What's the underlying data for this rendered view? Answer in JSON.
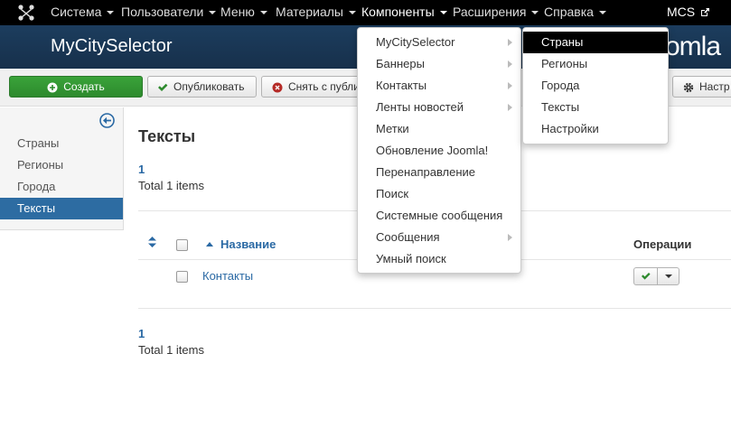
{
  "navbar": {
    "items": [
      "Система",
      "Пользователи",
      "Меню",
      "Материалы",
      "Компоненты",
      "Расширения",
      "Справка"
    ],
    "active": "Компоненты",
    "user": "MCS"
  },
  "header": {
    "title": "MyCitySelector",
    "joomla_fragment": "omla"
  },
  "toolbar": {
    "new": "Создать",
    "publish": "Опубликовать",
    "unpublish": "Снять с публи",
    "options": "Настр"
  },
  "sidebar": {
    "items": [
      "Страны",
      "Регионы",
      "Города",
      "Тексты"
    ],
    "active": "Тексты"
  },
  "main": {
    "title": "Тексты",
    "pagination_top": {
      "page": "1",
      "total": "Total 1 items"
    },
    "pagination_bottom": {
      "page": "1",
      "total": "Total 1 items"
    },
    "table": {
      "col_name": "Название",
      "col_ops": "Операции",
      "rows": [
        {
          "name": "Контакты",
          "published": true
        }
      ]
    }
  },
  "components_menu": {
    "items": [
      {
        "label": "MyCitySelector",
        "submenu": true
      },
      {
        "label": "Баннеры",
        "submenu": true
      },
      {
        "label": "Контакты",
        "submenu": true
      },
      {
        "label": "Ленты новостей",
        "submenu": true
      },
      {
        "label": "Метки",
        "submenu": false
      },
      {
        "label": "Обновление Joomla!",
        "submenu": false
      },
      {
        "label": "Перенаправление",
        "submenu": false
      },
      {
        "label": "Поиск",
        "submenu": false
      },
      {
        "label": "Системные сообщения",
        "submenu": false
      },
      {
        "label": "Сообщения",
        "submenu": true
      },
      {
        "label": "Умный поиск",
        "submenu": false
      }
    ]
  },
  "submenu": {
    "items": [
      "Страны",
      "Регионы",
      "Города",
      "Тексты",
      "Настройки"
    ],
    "active": "Страны"
  },
  "colors": {
    "accent": "#2d6ca2",
    "header": "#1c3d5e",
    "success": "#2d8a2d"
  }
}
